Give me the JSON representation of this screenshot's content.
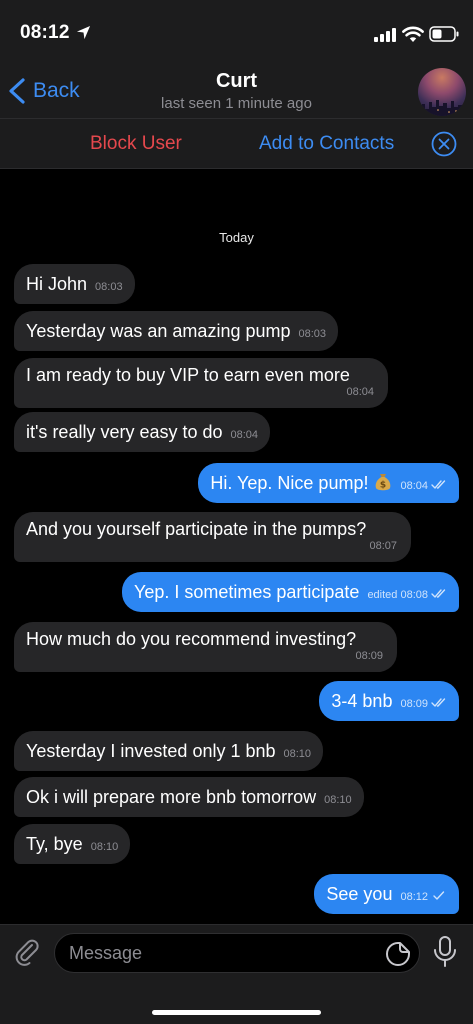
{
  "status_bar": {
    "time": "08:12"
  },
  "header": {
    "back_label": "Back",
    "title": "Curt",
    "subtitle": "last seen 1 minute ago"
  },
  "banner": {
    "block_label": "Block User",
    "add_label": "Add to Contacts"
  },
  "chat": {
    "date": "Today",
    "messages": [
      {
        "dir": "in",
        "text": "Hi John",
        "time": "08:03"
      },
      {
        "dir": "in",
        "text": "Yesterday was an amazing pump",
        "time": "08:03"
      },
      {
        "dir": "in",
        "text": "I am ready to buy VIP to earn even more",
        "time": "08:04"
      },
      {
        "dir": "in",
        "text": "it's really very easy to do",
        "time": "08:04"
      },
      {
        "dir": "out",
        "text": "Hi. Yep. Nice pump!",
        "time": "08:04",
        "emoji": "money-bag-icon",
        "status": "read"
      },
      {
        "dir": "in",
        "text": "And you yourself participate in the pumps?",
        "time": "08:07"
      },
      {
        "dir": "out",
        "text": "Yep. I sometimes participate",
        "time": "edited 08:08",
        "status": "read"
      },
      {
        "dir": "in",
        "text": "How much do you recommend investing?",
        "time": "08:09"
      },
      {
        "dir": "out",
        "text": "3-4 bnb",
        "time": "08:09",
        "status": "read"
      },
      {
        "dir": "in",
        "text": "Yesterday I invested only 1 bnb",
        "time": "08:10"
      },
      {
        "dir": "in",
        "text": "Ok i will prepare more bnb tomorrow",
        "time": "08:10"
      },
      {
        "dir": "in",
        "text": "Ty, bye",
        "time": "08:10"
      },
      {
        "dir": "out",
        "text": "See you",
        "time": "08:12",
        "status": "sent"
      }
    ]
  },
  "composer": {
    "placeholder": "Message"
  },
  "colors": {
    "accent": "#2c86f2",
    "link": "#3d8cf2",
    "danger": "#e5484d",
    "incoming_bubble": "#262628",
    "bar_background": "#1c1c1d"
  }
}
